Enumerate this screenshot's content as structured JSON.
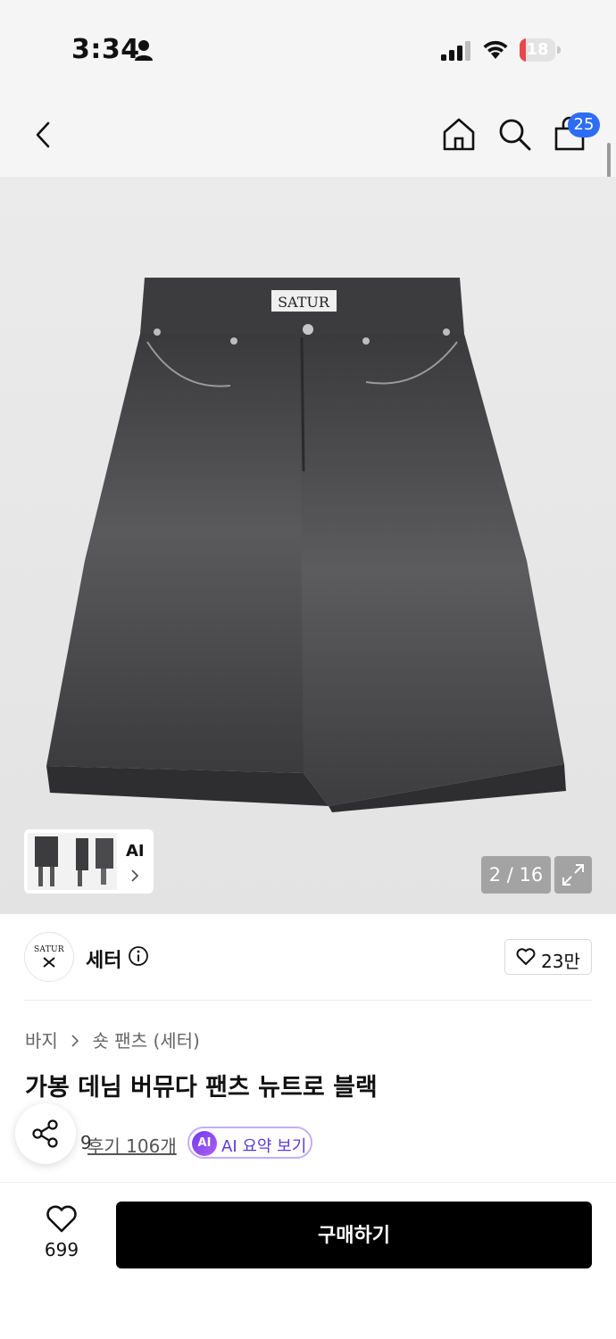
{
  "status_bar": {
    "time": "3:34",
    "battery": "18",
    "battery_level": 0.18
  },
  "nav": {
    "cart_count": "25"
  },
  "gallery": {
    "thumb_label": "AI",
    "counter": "2 / 16"
  },
  "product": {
    "logo_text": "SATUR",
    "brand_logo_text": "SATUR",
    "brand_name": "세터",
    "brand_likes": "23만",
    "breadcrumb": [
      "바지",
      "숏 팬츠 (세터)"
    ],
    "title": "가봉 데님 버뮤다 팬츠 뉴트로 블랙",
    "rating": "9",
    "review_link": "후기 106개",
    "ai_badge": "AI",
    "ai_summary_label": "AI 요약 보기"
  },
  "bottom_bar": {
    "wish_count": "699",
    "buy_label": "구매하기"
  },
  "colors": {
    "accent_blue": "#2d6df6",
    "battery_red": "#e5484d",
    "ai_purple": "#6f3cf0",
    "button_black": "#000000"
  }
}
